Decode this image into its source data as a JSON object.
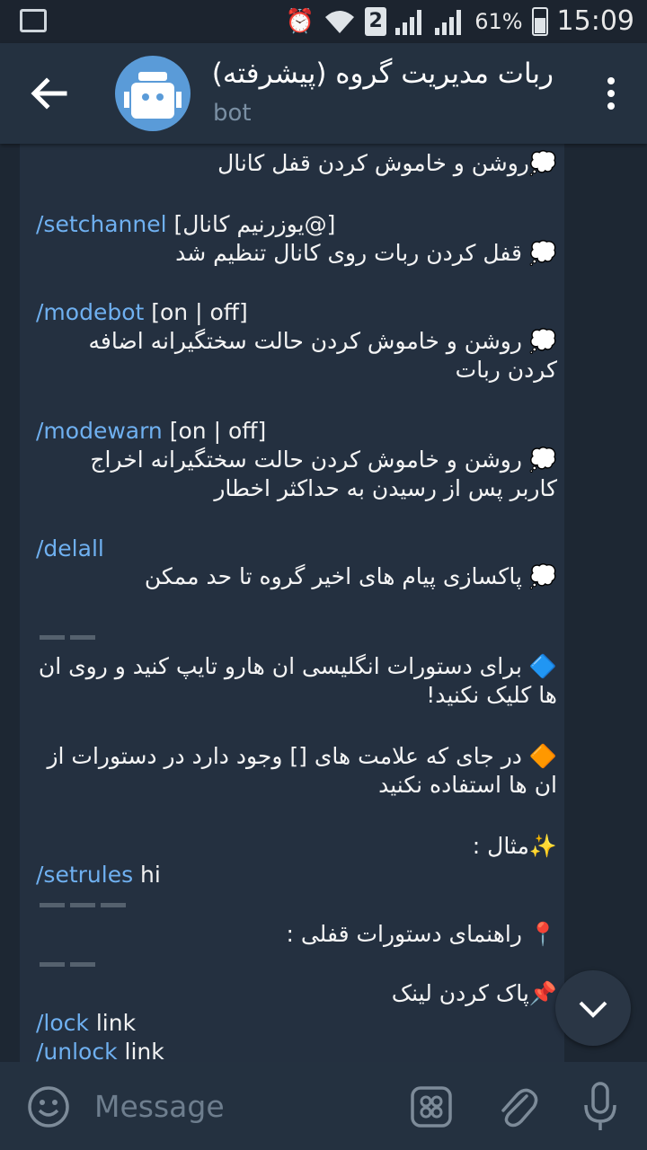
{
  "status": {
    "sim_badge": "2",
    "battery": "61%",
    "time": "15:09"
  },
  "header": {
    "title": "ربات مدیریت گروه (پیشرفته)",
    "subtitle": "bot"
  },
  "messages": [
    {
      "type": "rtl",
      "text": "💭روشن و خاموش کردن قفل کانال"
    },
    {
      "type": "cmd",
      "cmd": "/setchannel",
      "arg": " [یوزرنیم کانال@]"
    },
    {
      "type": "rtl",
      "text": "💭 قفل کردن ربات روی کانال تنظیم شد"
    },
    {
      "type": "cmd",
      "cmd": "/modebot",
      "arg": " [on | off]"
    },
    {
      "type": "rtl",
      "text": "💭 روشن و خاموش کردن حالت سختگیرانه اضافه"
    },
    {
      "type": "rtl",
      "text": "کردن ربات"
    },
    {
      "type": "cmd",
      "cmd": "/modewarn",
      "arg": " [on | off]"
    },
    {
      "type": "rtl",
      "text": "💭 روشن و خاموش کردن حالت سختگیرانه اخراج"
    },
    {
      "type": "rtl",
      "text": "کاربر پس از رسیدن به حداکثر اخطار"
    },
    {
      "type": "cmd",
      "cmd": "/delall",
      "arg": ""
    },
    {
      "type": "rtl",
      "text": "💭 پاکسازی پیام های اخیر گروه تا حد ممکن"
    },
    {
      "type": "rtl",
      "text": "🔷 برای دستورات انگلیسی ان هارو تایپ کنید و روی ان"
    },
    {
      "type": "rtl",
      "text": "ها کلیک نکنید!"
    },
    {
      "type": "rtl",
      "text": "🔶 در جای که علامت های [] وجود دارد در دستورات از"
    },
    {
      "type": "rtl",
      "text": "ان ها استفاده نکنید"
    },
    {
      "type": "rtl",
      "text": "✨مثال :"
    },
    {
      "type": "cmd",
      "cmd": "/setrules",
      "arg": " hi"
    },
    {
      "type": "rtl",
      "text": "📍 راهنمای دستورات قفلی :"
    },
    {
      "type": "rtl",
      "text": "📌پاک کردن لینک"
    },
    {
      "type": "cmd",
      "cmd": "/lock",
      "arg": " link"
    },
    {
      "type": "cmd",
      "cmd": "/unlock",
      "arg": " link"
    }
  ],
  "composer": {
    "placeholder": "Message"
  },
  "icons": [
    "back-arrow-icon",
    "bot-avatar",
    "more-vertical-icon",
    "scroll-down-icon",
    "emoji-icon",
    "bot-keyboard-icon",
    "attach-icon",
    "mic-icon"
  ]
}
